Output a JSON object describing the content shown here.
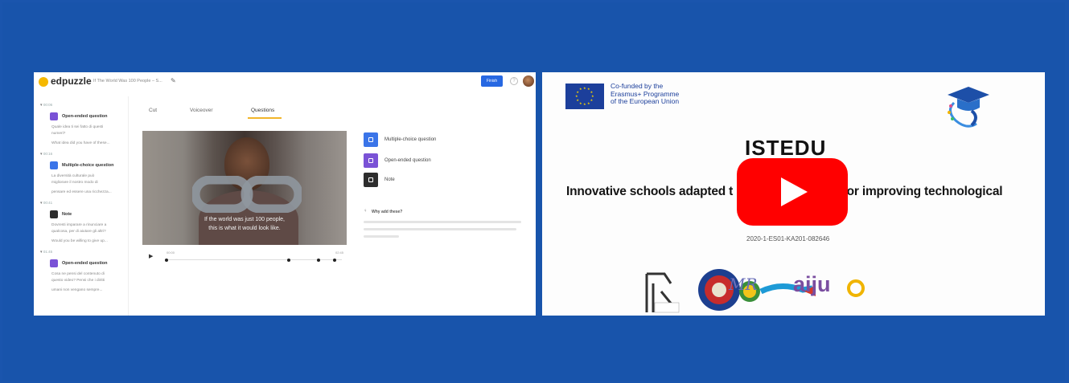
{
  "edpuzzle": {
    "logo": "edpuzzle",
    "title": "If The World Was 100 People – S...",
    "finish_label": "Finish",
    "help_icon": "?",
    "tabs": [
      "Cut",
      "Voiceover",
      "Questions"
    ],
    "active_tab": "Questions",
    "sidebar": [
      {
        "time": "00:06",
        "type": "Open-ended question",
        "lines": [
          "Quale idea ti sei fatto di questi",
          "numeri?",
          "What idea did you have of these..."
        ]
      },
      {
        "time": "00:16",
        "type": "Multiple-choice question",
        "lines": [
          "La diversità culturale può",
          "migliorare il nostro modo di",
          "pensare ed essere una ricchezza..."
        ]
      },
      {
        "time": "00:41",
        "type": "Note",
        "lines": [
          "Dovresti imparare a rinunciare a",
          "qualcosa, per di aiutare gli altri?",
          "Would you be willing to give up..."
        ]
      },
      {
        "time": "01:45",
        "type": "Open-ended question",
        "lines": [
          "Cosa ne pensi del contenuto di",
          "questo video? Pensi che i diritti",
          "umani non vengano sempre..."
        ]
      }
    ],
    "video": {
      "caption_line1": "If the world was just 100 people,",
      "caption_line2": "this is what it would look like.",
      "time_start": "00:00",
      "time_end": "02:45",
      "marker_positions_pct": [
        1,
        70,
        87,
        96
      ]
    },
    "options": [
      {
        "label": "Multiple-choice question",
        "color": "#3a74e8"
      },
      {
        "label": "Open-ended question",
        "color": "#7a52d6"
      },
      {
        "label": "Note",
        "color": "#2d2d2d"
      }
    ],
    "why_title": "Why add these?"
  },
  "slide": {
    "eu_text_lines": [
      "Co-funded by the",
      "Erasmus+ Programme",
      "of the European Union"
    ],
    "title": "ISTEDU",
    "subtitle_left": "Innovative schools adapted t",
    "subtitle_right": "y for improving technological",
    "project_code": "2020-1-ES01-KA201-082646",
    "partner_logo_text": "aiju",
    "partner_mr": "MR"
  },
  "colors": {
    "background": "#1a55ad",
    "yt_red": "#ff0000",
    "edpuzzle_yellow": "#f5b800",
    "finish_blue": "#2768e2",
    "tab_underline": "#f1b52a"
  }
}
